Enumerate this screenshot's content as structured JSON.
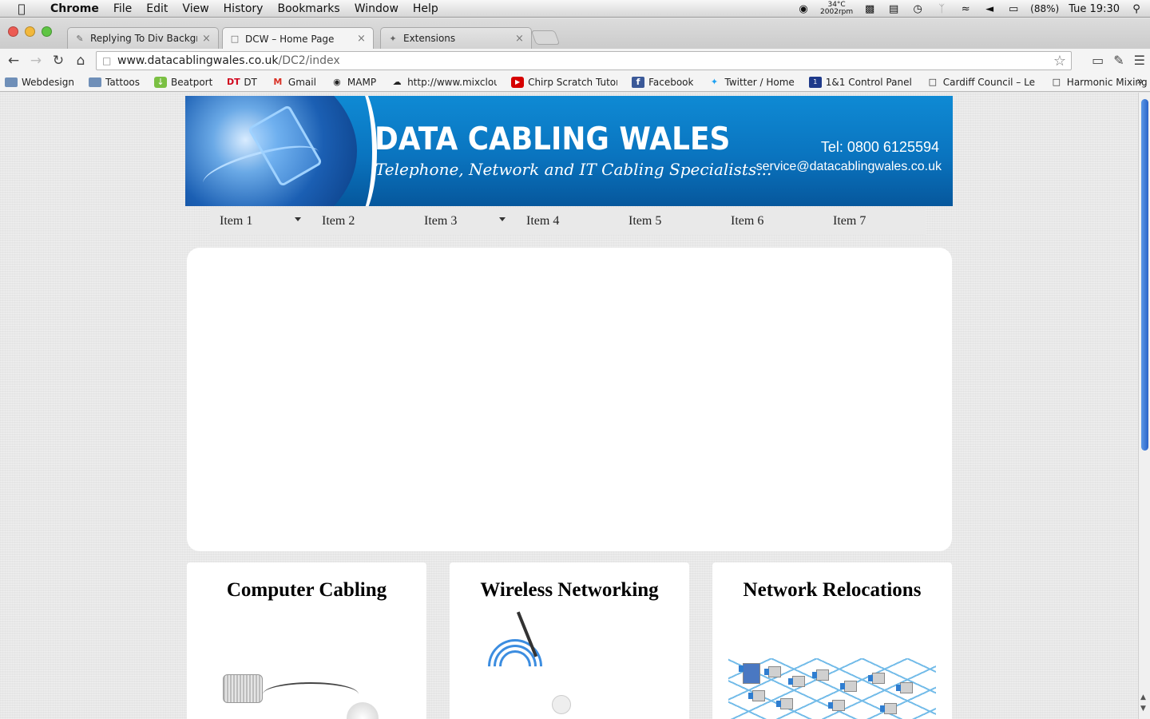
{
  "menubar": {
    "app": "Chrome",
    "items": [
      "File",
      "Edit",
      "View",
      "History",
      "Bookmarks",
      "Window",
      "Help"
    ],
    "temp": "34°C",
    "rpm": "2002rpm",
    "battery": "(88%)",
    "clock": "Tue 19:30"
  },
  "tabs": [
    {
      "title": "Replying To Div Backgroun",
      "icon": "bookmark-pin-icon"
    },
    {
      "title": "DCW – Home Page",
      "icon": "page-icon"
    },
    {
      "title": "Extensions",
      "icon": "puzzle-icon"
    }
  ],
  "address": {
    "url_host": "www.datacablingwales.co.uk",
    "url_path": "/DC2/index"
  },
  "bookmarks": [
    {
      "label": "Webdesign",
      "icon": "folder-icon"
    },
    {
      "label": "Tattoos",
      "icon": "folder-icon"
    },
    {
      "label": "Beatport",
      "icon": "beatport-icon"
    },
    {
      "label": "DT",
      "icon": "dt-icon"
    },
    {
      "label": "Gmail",
      "icon": "gmail-icon"
    },
    {
      "label": "MAMP",
      "icon": "mamp-icon"
    },
    {
      "label": "http://www.mixclou",
      "icon": "cloud-icon"
    },
    {
      "label": "Chirp Scratch Tutori",
      "icon": "youtube-icon"
    },
    {
      "label": "Facebook",
      "icon": "facebook-icon"
    },
    {
      "label": "Twitter / Home",
      "icon": "twitter-icon"
    },
    {
      "label": "1&1 Control Panel",
      "icon": "oneandone-icon"
    },
    {
      "label": "Cardiff Council – Lei",
      "icon": "page-icon"
    },
    {
      "label": "Harmonic Mixing Da",
      "icon": "page-icon"
    }
  ],
  "banner": {
    "title": "DATA CABLING WALES",
    "tagline": "Telephone, Network and IT Cabling Specialists...",
    "tel": "Tel: 0800 6125594",
    "email": "service@datacablingwales.co.uk"
  },
  "nav": [
    {
      "label": "Item 1",
      "dropdown": true
    },
    {
      "label": "Item 2",
      "dropdown": false
    },
    {
      "label": "Item 3",
      "dropdown": true
    },
    {
      "label": "Item 4",
      "dropdown": false
    },
    {
      "label": "Item 5",
      "dropdown": false
    },
    {
      "label": "Item 6",
      "dropdown": false
    },
    {
      "label": "Item 7",
      "dropdown": false
    }
  ],
  "cards": [
    {
      "title": "Computer Cabling"
    },
    {
      "title": "Wireless Networking"
    },
    {
      "title": "Network Relocations"
    }
  ],
  "colors": {
    "banner_blue": "#0a74bf",
    "page_bg": "#e8e8e8",
    "scroll_thumb": "#3f7fd8"
  }
}
